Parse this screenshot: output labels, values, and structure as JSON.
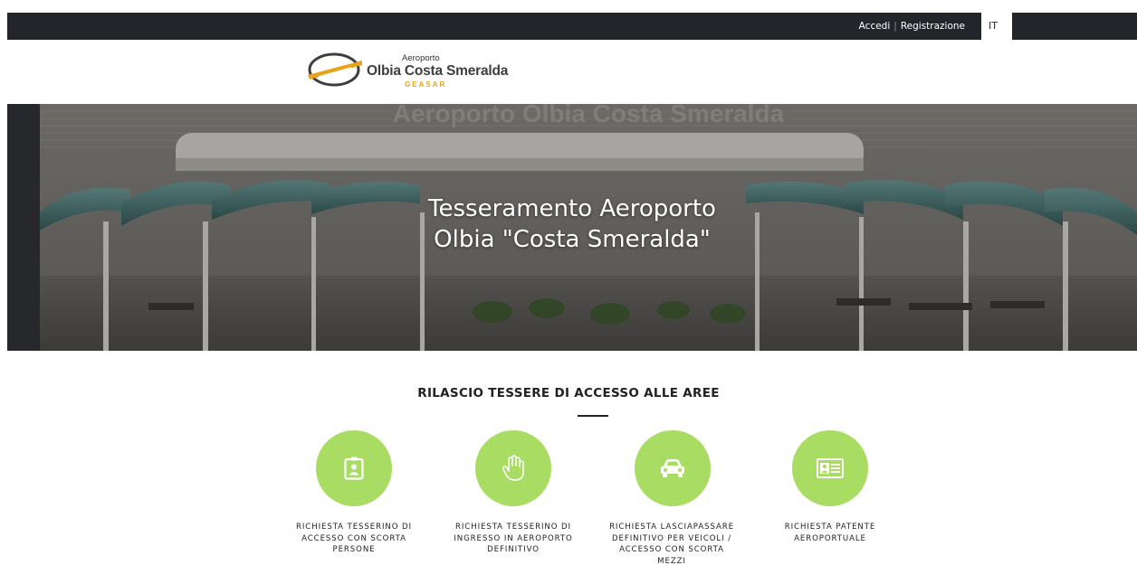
{
  "topbar": {
    "login_label": "Accedi",
    "separator": "|",
    "register_label": "Registrazione",
    "language": "IT"
  },
  "logo": {
    "small": "Aeroporto",
    "main": "Olbia Costa Smeralda",
    "sub": "GEASAR"
  },
  "hero": {
    "background_sign": "Aeroporto Olbia Costa Smeralda",
    "title_line1": "Tesseramento Aeroporto",
    "title_line2": "Olbia \"Costa Smeralda\""
  },
  "section": {
    "title": "RILASCIO TESSERE DI ACCESSO ALLE AREE"
  },
  "cards": [
    {
      "label": "RICHIESTA TESSERINO DI ACCESSO CON SCORTA PERSONE",
      "icon": "badge-icon"
    },
    {
      "label": "RICHIESTA TESSERINO DI INGRESSO IN AEROPORTO DEFINITIVO",
      "icon": "hand-icon"
    },
    {
      "label": "RICHIESTA LASCIAPASSARE DEFINITIVO PER VEICOLI / ACCESSO CON SCORTA MEZZI",
      "icon": "car-icon"
    },
    {
      "label": "RICHIESTA PATENTE AEROPORTUALE",
      "icon": "id-card-icon"
    }
  ],
  "colors": {
    "topbar": "#23252a",
    "accent_green": "#a9dc62",
    "logo_orange": "#e9a31a"
  }
}
